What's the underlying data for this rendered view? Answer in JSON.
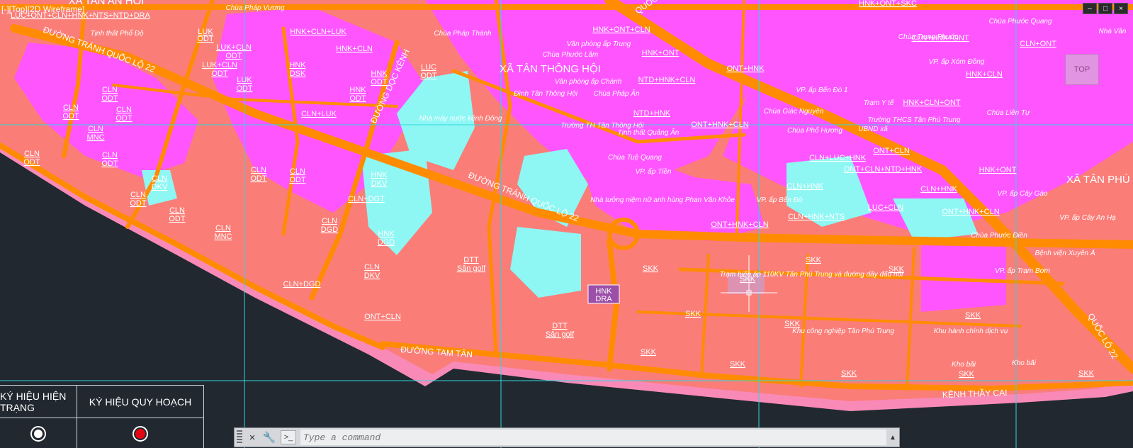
{
  "viewport": {
    "label": "[-][Top][2D Wireframe]"
  },
  "viewcube": {
    "label": "TOP"
  },
  "window_controls": [
    "–",
    "□",
    "×"
  ],
  "map": {
    "top_strip": "LUC+ONT+CLN+HNK+NTS+NTD+DRA",
    "top_left_partial": "XA TAN AN HOI",
    "roads": {
      "tranh_ql22": "ĐƯỜNG TRÁNH QUỐC LỘ 22",
      "tranh_ql22_b": "ĐƯỜNG TRÁNH QUỐC LỘ 22",
      "tam_tan": "ĐƯỜNG TAM TÂN",
      "ql22_a": "QUỐC LỘ 22",
      "ql22_b": "QUỐC LỘ 22",
      "dong_doc_kenh": "ĐƯỜNG DỌC KÊNH"
    },
    "places": {
      "xa_tan_thong_hoi": "XÃ TÂN THÔNG HỘI",
      "xa_tan_phu": "XÃ TÂN PHÚ"
    },
    "zone_labels": [
      "LUK",
      "ODT",
      "LUK+CLN",
      "ODT",
      "LUK+CLN",
      "ODT",
      "LUK",
      "ODT",
      "HNK",
      "DSK",
      "HNK",
      "ODT",
      "HNK",
      "ODT",
      "LUC",
      "ODT",
      "CLN",
      "ODT",
      "CLN",
      "ODT",
      "CLN",
      "ODT",
      "CLN",
      "MNC",
      "CLN",
      "ODT",
      "CLN",
      "ODT",
      "CLN",
      "DKV",
      "CLN",
      "ODT",
      "CLN",
      "ODT",
      "CLN",
      "MNC",
      "CLN",
      "ODT",
      "CLN",
      "ODT",
      "HNK",
      "DKV",
      "HNK",
      "DGD",
      "CLN",
      "DGD",
      "CLN",
      "DKV",
      "DTT",
      "Sân golf",
      "DTT",
      "Sân golf",
      "SKK",
      "SKK",
      "SKK",
      "SKK",
      "SKK",
      "SKK",
      "SKK",
      "SKK",
      "SKK",
      "SKK",
      "SKK",
      "SKK"
    ],
    "top_labels": [
      "HNK+CLN+LUK",
      "HNK+CLN",
      "HNK+ONT+CLN",
      "HNK+ONT",
      "NTD+HNK+CLN",
      "NTD+HNK",
      "ONT+HNK",
      "ONT+HNK+CLN",
      "CLN+LUC+HNK",
      "CLN+HNK",
      "CLN+HNK+NTS",
      "LUC+CLN",
      "ONT+HNK+CLN",
      "CLN+HNK",
      "ONT+HNK+CLN",
      "ONT+CLN",
      "HNK+ONT",
      "CLN+ONT",
      "HNK+CLN",
      "HNK+ONT+SKC",
      "CLN+HNK+ONT",
      "HNK+CLN+ONT",
      "ONT+CLN+NTD+HNK",
      "CLN+LUK",
      "CLN+DGT",
      "CLN+DGD",
      "ONT+CLN"
    ],
    "annotations": [
      "Tịnh thất Phổ Độ",
      "Chùa Pháp Vương",
      "Chùa Pháp Thành",
      "Văn phòng ấp Trung",
      "Chùa Phước Lâm",
      "Nhà máy nước kênh Đông",
      "Văn phòng ấp Chánh",
      "Đình Tân Thông Hội",
      "Chùa Pháp Ân",
      "Trường TH Tân Thông Hội",
      "Tịnh thất Quảng Ân",
      "Chùa Tuệ Quang",
      "VP. ấp Tiền",
      "Nhà tưởng niệm nữ anh hùng Phan Văn Khỏe",
      "VP. ấp Bến Đò",
      "VP. ấp Bến Đò 1",
      "Chùa Giác Nguyên",
      "Chùa Phổ Hương",
      "UBND xã",
      "Trường THCS Tân Phú Trung",
      "Trạm Y tế",
      "Chùa Trung Phước",
      "VP. ấp Xóm Đồng",
      "Trạm biến áp 110KV Tân Phú Trung và đường dây đấu nối",
      "Khu công nghiệp Tân Phú Trung",
      "Khu hành chính dịch vụ",
      "Kho bãi",
      "Kho bãi",
      "Chùa Phước Điền",
      "Bệnh viện Xuyên Á",
      "VP. ấp Trạm Bơm",
      "VP. ấp Cây Gáo",
      "VP. ấp Cây An Hạ",
      "Chùa Liên Tự",
      "Chùa Phước Quang",
      "Nhà Vân"
    ],
    "hnk_box": {
      "top": "HNK",
      "bottom": "DRA"
    },
    "canal_label": "KÊNH THẦY CAI"
  },
  "legend": {
    "col1_header": "KÝ HIỆU HIỆN TRẠNG",
    "col2_header": "KÝ HIỆU QUY HOẠCH",
    "col1_symbol": "white-circle",
    "col2_symbol": "red-circle",
    "colors": {
      "existing": "#ffffff",
      "planned": "#e30613"
    }
  },
  "command_bar": {
    "placeholder": "Type a command",
    "close_icon": "×",
    "settings_icon": "🔧",
    "prompt_icon": ">_"
  },
  "colors": {
    "background": "#212830",
    "pink_zone": "#f98ab8",
    "magenta_zone": "#ff55ff",
    "salmon_zone": "#fa7d78",
    "cyan_water": "#8ef7f4",
    "orange_road": "#ff8c00",
    "crosshair": "#2fd8dc"
  }
}
